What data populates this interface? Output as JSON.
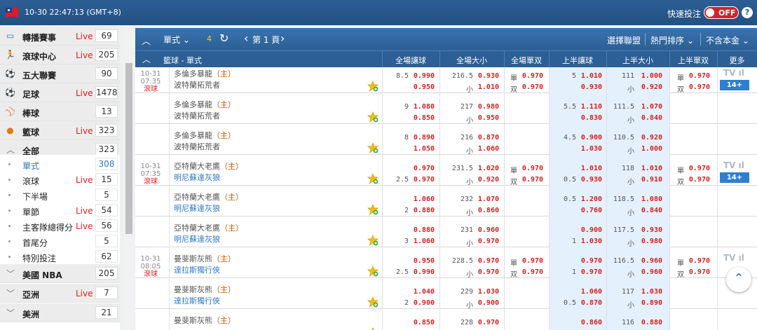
{
  "header": {
    "time": "10-30 22:47:13 (GMT+8)",
    "quick_bet": "快速投注",
    "toggle": "OFF",
    "help": "?"
  },
  "sidebar": {
    "sports": [
      {
        "label": "轉播賽事",
        "live": "Live",
        "count": "69",
        "icon": "tv-icon"
      },
      {
        "label": "滾球中心",
        "live": "Live",
        "count": "205",
        "icon": "runner-icon"
      },
      {
        "label": "五大聯賽",
        "live": "",
        "count": "90",
        "icon": "soccer-ball-icon"
      },
      {
        "label": "足球",
        "live": "Live",
        "count": "1478",
        "icon": "soccer-ball-icon"
      },
      {
        "label": "棒球",
        "live": "",
        "count": "13",
        "icon": "baseball-icon"
      },
      {
        "label": "籃球",
        "live": "Live",
        "count": "323",
        "icon": "basketball-icon"
      }
    ],
    "basketball_sub": [
      {
        "label": "全部",
        "live": "",
        "count": "323"
      },
      {
        "label": "單式",
        "live": "",
        "count": "308"
      },
      {
        "label": "滾球",
        "live": "Live",
        "count": "15"
      },
      {
        "label": "下半場",
        "live": "",
        "count": "5"
      },
      {
        "label": "單節",
        "live": "Live",
        "count": "54"
      },
      {
        "label": "主客隊總得分",
        "live": "Live",
        "count": "56"
      },
      {
        "label": "首尾分",
        "live": "",
        "count": "5"
      },
      {
        "label": "特別投注",
        "live": "",
        "count": "62"
      }
    ],
    "leagues": [
      {
        "label": "美國 NBA",
        "live": "",
        "count": "205"
      },
      {
        "label": "亞洲",
        "live": "Live",
        "count": "7"
      },
      {
        "label": "美洲",
        "live": "",
        "count": "21"
      }
    ]
  },
  "toolbar": {
    "mode": "單式",
    "count": "4",
    "refresh": "C",
    "page": "第 1 頁",
    "select_league": "選擇聯盟",
    "popular_sort": "熱門排序",
    "principal": "不含本金"
  },
  "table_header": {
    "title": "籃球 - 單式",
    "cols": [
      "全場讓球",
      "全場大小",
      "全場單双",
      "上半讓球",
      "上半大小",
      "上半單双",
      "更多"
    ]
  },
  "rows": [
    {
      "date": "10-31",
      "time": "07:35",
      "live": "滾球",
      "home": "多倫多暴龍",
      "home_tag": "（主）",
      "away": "波特蘭拓荒者",
      "away_blue": false,
      "hc": [
        "8.5",
        "0.990",
        "",
        "0.950"
      ],
      "ou": [
        "216.5",
        "0.930",
        "小",
        "1.010"
      ],
      "oe": [
        "單",
        "0.970",
        "双",
        "0.970"
      ],
      "hhc": [
        "5",
        "1.010",
        "",
        "0.930"
      ],
      "hou": [
        "111",
        "1.000",
        "小",
        "0.920"
      ],
      "hoe": [
        "單",
        "0.970",
        "双",
        "0.970"
      ],
      "tv": "TV",
      "more": "14+"
    },
    {
      "date": "",
      "time": "",
      "live": "",
      "home": "多倫多暴龍",
      "home_tag": "（主）",
      "away": "波特蘭拓荒者",
      "away_blue": false,
      "hc": [
        "9",
        "1.080",
        "",
        "0.850"
      ],
      "ou": [
        "217",
        "0.980",
        "小",
        "0.950"
      ],
      "oe": [
        "",
        "",
        "",
        ""
      ],
      "hhc": [
        "5.5",
        "1.110",
        "",
        "0.830"
      ],
      "hou": [
        "111.5",
        "1.070",
        "小",
        "0.840"
      ],
      "hoe": [
        "",
        "",
        "",
        ""
      ],
      "tv": "",
      "more": ""
    },
    {
      "date": "",
      "time": "",
      "live": "",
      "home": "多倫多暴龍",
      "home_tag": "（主）",
      "away": "波特蘭拓荒者",
      "away_blue": false,
      "hc": [
        "8",
        "0.890",
        "",
        "1.050"
      ],
      "ou": [
        "216",
        "0.870",
        "小",
        "1.060"
      ],
      "oe": [
        "",
        "",
        "",
        ""
      ],
      "hhc": [
        "4.5",
        "0.900",
        "",
        "1.030"
      ],
      "hou": [
        "110.5",
        "0.920",
        "小",
        "1.000"
      ],
      "hoe": [
        "",
        "",
        "",
        ""
      ],
      "tv": "",
      "more": ""
    },
    {
      "date": "10-31",
      "time": "07:35",
      "live": "滾球",
      "home": "亞特蘭大老鷹",
      "home_tag": "（主）",
      "away": "明尼蘇達灰狼",
      "away_blue": true,
      "hc": [
        "",
        "0.970",
        "2.5",
        "0.970"
      ],
      "ou": [
        "231.5",
        "1.020",
        "小",
        "0.920"
      ],
      "oe": [
        "單",
        "0.970",
        "双",
        "0.970"
      ],
      "hhc": [
        "",
        "1.010",
        "0.5",
        "0.930"
      ],
      "hou": [
        "118",
        "1.010",
        "小",
        "0.910"
      ],
      "hoe": [
        "單",
        "0.970",
        "双",
        "0.970"
      ],
      "tv": "TV",
      "more": "14+"
    },
    {
      "date": "",
      "time": "",
      "live": "",
      "home": "亞特蘭大老鷹",
      "home_tag": "（主）",
      "away": "明尼蘇達灰狼",
      "away_blue": true,
      "hc": [
        "",
        "1.060",
        "2",
        "0.880"
      ],
      "ou": [
        "232",
        "1.070",
        "小",
        "0.860"
      ],
      "oe": [
        "",
        "",
        "",
        ""
      ],
      "hhc": [
        "0.5",
        "1.200",
        "",
        "0.760"
      ],
      "hou": [
        "118.5",
        "1.080",
        "小",
        "0.840"
      ],
      "hoe": [
        "",
        "",
        "",
        ""
      ],
      "tv": "",
      "more": ""
    },
    {
      "date": "",
      "time": "",
      "live": "",
      "home": "亞特蘭大老鷹",
      "home_tag": "（主）",
      "away": "明尼蘇達灰狼",
      "away_blue": true,
      "hc": [
        "",
        "0.880",
        "3",
        "1.060"
      ],
      "ou": [
        "231",
        "0.960",
        "小",
        "0.970"
      ],
      "oe": [
        "",
        "",
        "",
        ""
      ],
      "hhc": [
        "",
        "0.900",
        "1",
        "1.030"
      ],
      "hou": [
        "117.5",
        "0.930",
        "小",
        "0.980"
      ],
      "hoe": [
        "",
        "",
        "",
        ""
      ],
      "tv": "",
      "more": ""
    },
    {
      "date": "10-31",
      "time": "08:05",
      "live": "滾球",
      "home": "曼斐斯灰熊",
      "home_tag": "（主）",
      "away": "達拉斯獨行俠",
      "away_blue": true,
      "hc": [
        "",
        "0.950",
        "2.5",
        "0.990"
      ],
      "ou": [
        "228.5",
        "0.970",
        "小",
        "0.970"
      ],
      "oe": [
        "單",
        "0.970",
        "双",
        "0.970"
      ],
      "hhc": [
        "",
        "0.970",
        "1",
        "0.970"
      ],
      "hou": [
        "116.5",
        "0.960",
        "小",
        "0.960"
      ],
      "hoe": [
        "單",
        "0.970",
        "双",
        "0.970"
      ],
      "tv": "TV",
      "more": ""
    },
    {
      "date": "",
      "time": "",
      "live": "",
      "home": "曼斐斯灰熊",
      "home_tag": "（主）",
      "away": "達拉斯獨行俠",
      "away_blue": true,
      "hc": [
        "",
        "1.040",
        "2",
        "0.900"
      ],
      "ou": [
        "229",
        "1.030",
        "小",
        "0.900"
      ],
      "oe": [
        "",
        "",
        "",
        ""
      ],
      "hhc": [
        "",
        "1.060",
        "0.5",
        "0.870"
      ],
      "hou": [
        "117",
        "1.030",
        "小",
        "0.890"
      ],
      "hoe": [
        "",
        "",
        "",
        ""
      ],
      "tv": "",
      "more": ""
    },
    {
      "date": "",
      "time": "",
      "live": "",
      "home": "曼斐斯灰熊",
      "home_tag": "（主）",
      "away": "",
      "away_blue": true,
      "hc": [
        "",
        "0.850",
        "",
        ""
      ],
      "ou": [
        "228",
        "0.970",
        "",
        ""
      ],
      "oe": [
        "",
        "",
        "",
        ""
      ],
      "hhc": [
        "",
        "0.860",
        "",
        ""
      ],
      "hou": [
        "116",
        "0.880",
        "",
        ""
      ],
      "hoe": [
        "",
        "",
        "",
        ""
      ],
      "tv": "",
      "more": ""
    }
  ],
  "colors": {
    "header_blue": "#2b5f95",
    "odds_red": "#d61f1f",
    "live_red": "#e02020",
    "link_blue": "#2f79c4",
    "half_shade": "#e4f0fb"
  }
}
